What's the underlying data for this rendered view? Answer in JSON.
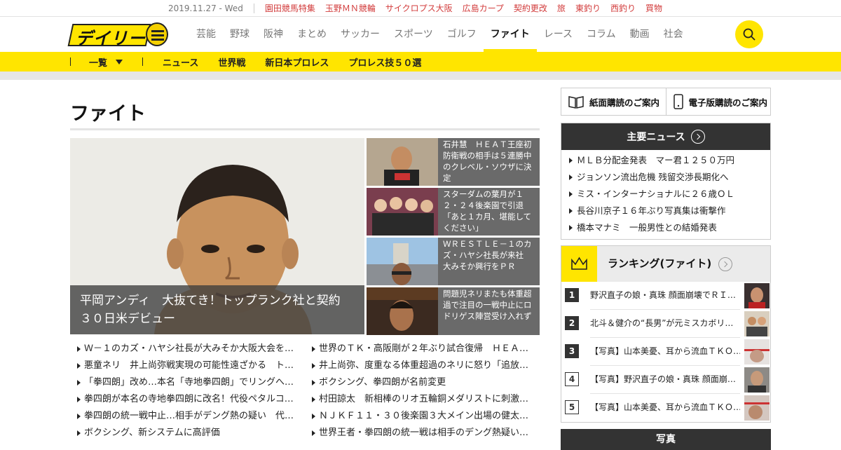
{
  "topstrip": {
    "date": "2019.11.27 - Wed",
    "links": [
      "園田競馬特集",
      "玉野ＭＮ競輪",
      "サイクロプス大阪",
      "広島カープ",
      "契約更改",
      "旅",
      "東釣り",
      "西釣り",
      "買物"
    ]
  },
  "logo": {
    "text": "デイリー"
  },
  "nav": {
    "items": [
      "芸能",
      "野球",
      "阪神",
      "まとめ",
      "サッカー",
      "スポーツ",
      "ゴルフ",
      "ファイト",
      "レース",
      "コラム",
      "動画",
      "社会"
    ],
    "active": "ファイト"
  },
  "subnav": {
    "all_label": "一覧",
    "items": [
      "ニュース",
      "世界戦",
      "新日本プロレス",
      "プロレス技５０選"
    ]
  },
  "page": {
    "title": "ファイト"
  },
  "hero": {
    "caption": "平岡アンディ　大抜てき！トップランク社と契約　３０日米デビュー"
  },
  "side_articles": [
    {
      "text": "石井慧　ＨＥＡＴ王座初防衛戦の相手は５連勝中のクレベル・ソウザに決定"
    },
    {
      "text": "スターダムの葉月が１２・２４後楽園で引退「あと１カ月、堪能してください」"
    },
    {
      "text": "ＷＲＥＳＴＬＥ－１のカズ・ハヤシ社長が来社　大みそか興行をＰＲ"
    },
    {
      "text": "問題児ネリまたも体重超過で注目の一戦中止にロドリゲス陣営受け入れず"
    }
  ],
  "headlines_left": [
    "Ｗ－１のカズ・ハヤシ社長が大みそか大阪大会を…",
    "悪童ネリ　井上尚弥戦実現の可能性遠ざかる　ト…",
    "「拳四朗」改め…本名「寺地拳四朗」でリングへ…",
    "拳四朗が本名の寺地拳四朗に改名！代役ペタルコ…",
    "拳四朗の統一戦中止…相手がデング熱の疑い　代…",
    "ボクシング、新システムに高評価"
  ],
  "headlines_right": [
    "世界のＴＫ・高阪剛が２年ぶり試合復帰　ＨＥＡ…",
    "井上尚弥、度重なる体重超過のネリに怒り「追放…",
    "ボクシング、拳四朗が名前変更",
    "村田諒太　新相棒のリオ五輪銅メダリストに刺激…",
    "ＮＪＫＦ１１・３０後楽園３大メイン出場の健太…",
    "世界王者・拳四朗の統一戦は相手のデング熱疑い…"
  ],
  "subscribe": {
    "paper_label": "紙面購読のご案内",
    "digital_label": "電子版購読のご案内"
  },
  "top_news": {
    "title": "主要ニュース",
    "items": [
      "ＭＬＢ分配金発表　マー君１２５０万円",
      "ジョンソン流出危機 残留交渉長期化へ",
      "ミス・インターナショナルに２６歳ＯＬ",
      "長谷川京子１６年ぶり写真集は衝撃作",
      "橋本マナミ　一般男性との結婚発表"
    ]
  },
  "ranking": {
    "title": "ランキング(ファイト)",
    "items": [
      {
        "rank": "1",
        "text": "野沢直子の娘・真珠 顔面崩壊でＲＩ…"
      },
      {
        "rank": "2",
        "text": "北斗＆健介の“長男”が元ミスカボリ…"
      },
      {
        "rank": "3",
        "text": "【写真】山本美憂、耳から流血ＴＫＯ…"
      },
      {
        "rank": "4",
        "text": "【写真】野沢直子の娘・真珠 顔面崩…"
      },
      {
        "rank": "5",
        "text": "【写真】山本美憂、耳から流血ＴＫＯ…"
      }
    ]
  },
  "photo_section": {
    "title": "写真"
  },
  "colors": {
    "brand_yellow": "#ffe500",
    "accent_red": "#d23c3c",
    "dark": "#333333"
  }
}
